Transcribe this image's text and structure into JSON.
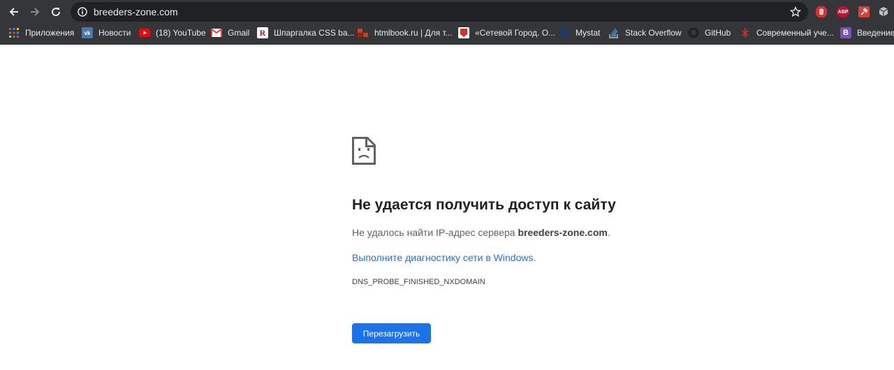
{
  "browser": {
    "url": "breeders-zone.com",
    "extensions": [
      "adblock-shield-icon",
      "abp-icon",
      "pin-extension-icon",
      "cube-extension-icon"
    ],
    "ext_abp_label": "ABP"
  },
  "bookmarks": [
    {
      "label": "Приложения",
      "icon": "apps-grid-icon"
    },
    {
      "label": "Новости",
      "icon": "vk-icon"
    },
    {
      "label": "(18) YouTube",
      "icon": "youtube-icon"
    },
    {
      "label": "Gmail",
      "icon": "gmail-icon"
    },
    {
      "label": "Шпаргалка CSS ba...",
      "icon": "r-icon"
    },
    {
      "label": "htmlbook.ru | Для т...",
      "icon": "htmlbook-icon"
    },
    {
      "label": "«Сетевой Город. О...",
      "icon": "netcity-icon"
    },
    {
      "label": "Mystat",
      "icon": "mystat-icon"
    },
    {
      "label": "Stack Overflow",
      "icon": "stackoverflow-icon"
    },
    {
      "label": "GitHub",
      "icon": "github-icon"
    },
    {
      "label": "Современный уче...",
      "icon": "modern-learning-icon"
    },
    {
      "label": "Введение.",
      "icon": "bootstrap-icon"
    }
  ],
  "error": {
    "title": "Не удается получить доступ к сайту",
    "desc_prefix": "Не удалось найти IP-адрес сервера ",
    "desc_host": "breeders-zone.com",
    "desc_suffix": ".",
    "diagnose_link": "Выполните диагностику сети в Windows.",
    "error_code": "DNS_PROBE_FINISHED_NXDOMAIN",
    "reload_button": "Перезагрузить"
  },
  "colors": {
    "chrome_bg": "#35363a",
    "omnibox_bg": "#202124",
    "link": "#1a73e8",
    "button": "#1a73e8"
  }
}
